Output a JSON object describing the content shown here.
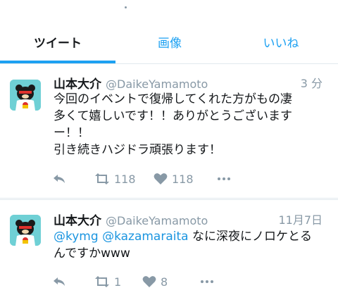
{
  "tabs": [
    {
      "label": "ツイート"
    },
    {
      "label": "画像"
    },
    {
      "label": "いいね"
    }
  ],
  "tweets": [
    {
      "name": "山本大介",
      "handle": "@DaikeYamamoto",
      "time": "3 分",
      "lines": [
        "今回のイベントで復帰してくれた方がもの凄",
        "多くて嬉しいです！！ありがとうございます",
        "ー！！",
        "引き続きハジドラ頑張ります！"
      ],
      "retweets": "118",
      "likes": "118"
    },
    {
      "name": "山本大介",
      "handle": "@DaikeYamamoto",
      "time": "11月7日",
      "mention_1": "@kymg",
      "mention_2": "@kazamaraita",
      "text_1": " なに深夜にノロケとる",
      "text_2": "んですかwww",
      "retweets": "1",
      "likes": "8"
    }
  ],
  "icons": {
    "reply": "reply-icon",
    "retweet": "retweet-icon",
    "like": "heart-icon",
    "more": "more-icon"
  },
  "colors": {
    "accent": "#1da1f2",
    "mention": "#1b95e0",
    "muted": "#8899a6",
    "avatar_bg": "#6fd0d5"
  }
}
